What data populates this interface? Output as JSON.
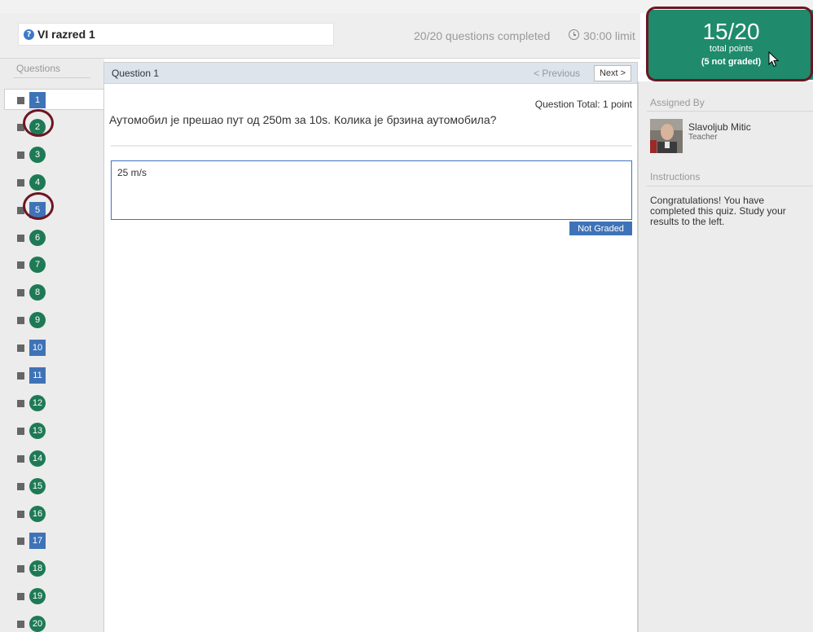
{
  "header": {
    "quiz_title": "VI razred 1",
    "progress": "20/20 questions completed",
    "time_limit": "30:00 limit",
    "help_icon": "question-mark-icon",
    "clock_icon": "clock-icon"
  },
  "score": {
    "value": "15/20",
    "label": "total points",
    "not_graded": "(5 not graded)",
    "bg_color": "#1f8a6c"
  },
  "sidebar": {
    "questions_heading": "Questions",
    "items": [
      {
        "n": "1",
        "status": "square"
      },
      {
        "n": "2",
        "status": "round"
      },
      {
        "n": "3",
        "status": "round"
      },
      {
        "n": "4",
        "status": "round"
      },
      {
        "n": "5",
        "status": "square"
      },
      {
        "n": "6",
        "status": "round"
      },
      {
        "n": "7",
        "status": "round"
      },
      {
        "n": "8",
        "status": "round"
      },
      {
        "n": "9",
        "status": "round"
      },
      {
        "n": "10",
        "status": "square"
      },
      {
        "n": "11",
        "status": "square"
      },
      {
        "n": "12",
        "status": "round"
      },
      {
        "n": "13",
        "status": "round"
      },
      {
        "n": "14",
        "status": "round"
      },
      {
        "n": "15",
        "status": "round"
      },
      {
        "n": "16",
        "status": "round"
      },
      {
        "n": "17",
        "status": "square"
      },
      {
        "n": "18",
        "status": "round"
      },
      {
        "n": "19",
        "status": "round"
      },
      {
        "n": "20",
        "status": "round"
      }
    ],
    "square_color": "#3f73b8",
    "round_color": "#1e7a55"
  },
  "question": {
    "header_title": "Question 1",
    "previous_label": "< Previous",
    "next_label": "Next >",
    "total": "Question Total: 1 point",
    "text": "Аутомобил је прешао пут од 250m за 10s. Колика је брзина аутомобила?",
    "answer": "25 m/s",
    "grade_status": "Not Graded"
  },
  "right_panel": {
    "assigned_heading": "Assigned By",
    "teacher_name": "Slavoljub Mitic",
    "teacher_role": "Teacher",
    "instructions_heading": "Instructions",
    "instructions_text": "Congratulations! You have completed this quiz. Study your results to the left."
  }
}
